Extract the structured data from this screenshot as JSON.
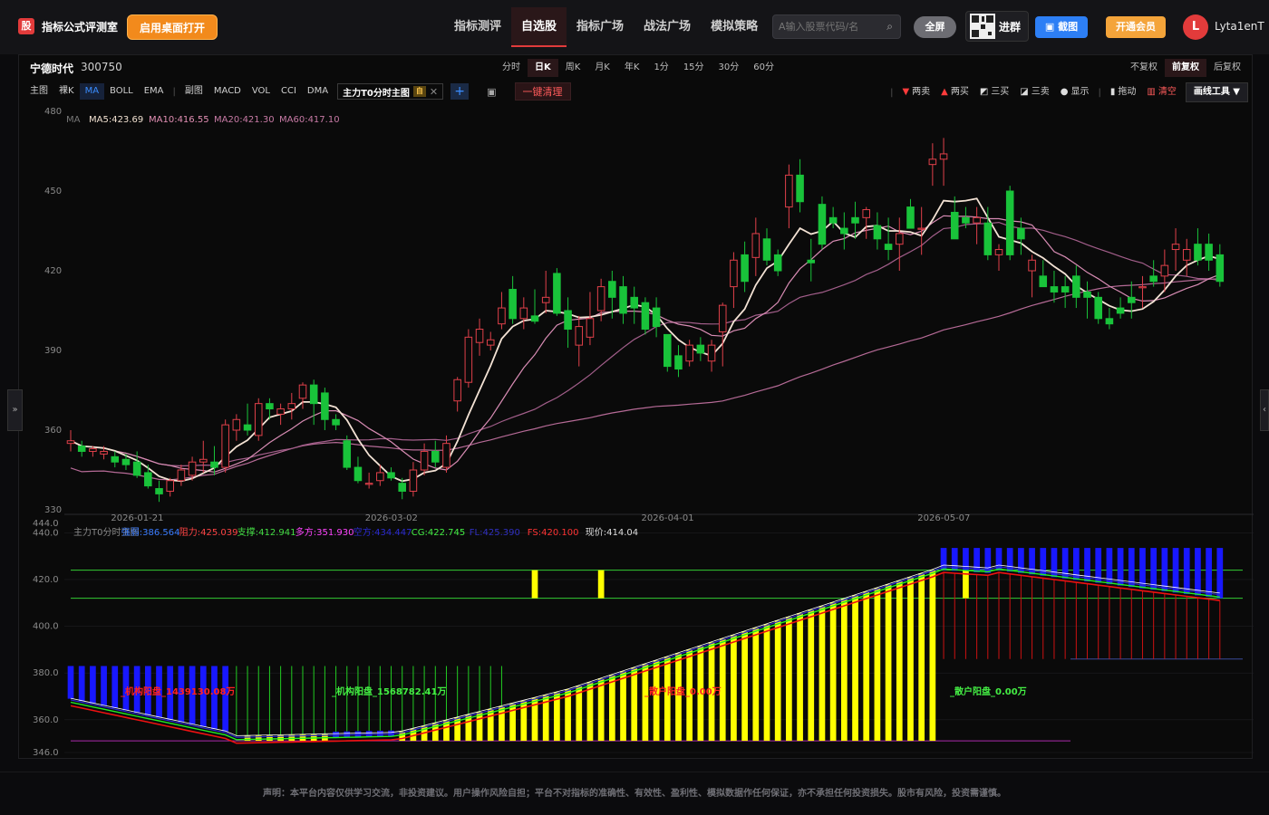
{
  "header": {
    "logo_mark": "股",
    "logo_text": "指标公式评测室",
    "desktop_button": "启用桌面打开",
    "nav": [
      "指标测评",
      "自选股",
      "指标广场",
      "战法广场",
      "模拟策略"
    ],
    "nav_active": 1,
    "search_placeholder": "A输入股票代码/名",
    "fullscreen": "全屏",
    "join_group": "进群",
    "screenshot": "截图",
    "member": "开通会员",
    "avatar_letter": "L",
    "username": "Lyta1enT"
  },
  "stock": {
    "name": "宁德时代",
    "code": "300750"
  },
  "periods": [
    "分时",
    "日K",
    "周K",
    "月K",
    "年K",
    "1分",
    "15分",
    "30分",
    "60分"
  ],
  "period_active": 1,
  "adjust": [
    "不复权",
    "前复权",
    "后复权"
  ],
  "adjust_active": 1,
  "indicators_main": [
    "主图",
    "裸K",
    "MA",
    "BOLL",
    "EMA"
  ],
  "indicator_active": 2,
  "indicators_sub": [
    "副图",
    "MACD",
    "VOL",
    "CCI",
    "DMA"
  ],
  "custom_indicator": {
    "name": "主力T0分时主图",
    "badge": "自"
  },
  "clear_all": "一键清理",
  "tools": [
    {
      "icon": "▼",
      "label": "两卖",
      "color": "#ff3b3b"
    },
    {
      "icon": "▲",
      "label": "两买",
      "color": "#ff3b3b"
    },
    {
      "icon": "◩",
      "label": "三买",
      "color": "#dddddd"
    },
    {
      "icon": "◪",
      "label": "三卖",
      "color": "#dddddd"
    },
    {
      "icon": "●",
      "label": "显示",
      "color": "#dddddd"
    },
    {
      "icon": "▮",
      "label": "拖动",
      "color": "#dddddd"
    },
    {
      "icon": "▥",
      "label": "清空",
      "color": "#ff5b5b"
    }
  ],
  "draw_tools": "画线工具 ▼",
  "ma_legend": [
    {
      "label": "MA",
      "color": "#777777"
    },
    {
      "label": "MA5:423.69",
      "color": "#f0e0d0"
    },
    {
      "label": "MA10:416.55",
      "color": "#e28fb4"
    },
    {
      "label": "MA20:421.30",
      "color": "#c77aa5"
    },
    {
      "label": "MA60:417.10",
      "color": "#c77aa5"
    }
  ],
  "sub_legend": [
    {
      "label": "主力T0分时主图",
      "color": "#8a8a8a"
    },
    {
      "label": "强弱:386.564",
      "color": "#3a7cff"
    },
    {
      "label": "阻力:425.039",
      "color": "#ff4444"
    },
    {
      "label": "支撑:412.941",
      "color": "#44dd44"
    },
    {
      "label": "多方:351.930",
      "color": "#ff44ff"
    },
    {
      "label": "空方:434.447",
      "color": "#2a2ad0"
    },
    {
      "label": "CG:422.745",
      "color": "#44ee44"
    },
    {
      "label": "FL:425.390",
      "color": "#3030c0"
    },
    {
      "label": "FS:420.100",
      "color": "#ff3333"
    },
    {
      "label": "现价:414.04",
      "color": "#dddddd"
    }
  ],
  "annotations": [
    {
      "text": "_机构阳盘_1439130.08万",
      "color": "#ff2222"
    },
    {
      "text": "_机构阳盘_1568782.41万",
      "color": "#44ee44"
    },
    {
      "text": "_散户阳盘_0.00万",
      "color": "#ff2222"
    },
    {
      "text": "_散户阳盘_0.00万",
      "color": "#44ee44"
    }
  ],
  "chart_data": {
    "type": "candlestick",
    "price_axis": {
      "ticks": [
        480,
        450,
        420,
        390,
        360,
        330
      ],
      "ylim": [
        330,
        480
      ]
    },
    "sub_axis": {
      "ticks": [
        "444.0",
        "440.0",
        "420.0",
        "400.0",
        "380.0",
        "360.0",
        "346.0"
      ],
      "ylim": [
        346,
        444
      ]
    },
    "date_labels": [
      "2026-01-21",
      "2026-03-02",
      "2026-04-01",
      "2026-05-07"
    ],
    "ohlc": [
      [
        355,
        360,
        352,
        356
      ],
      [
        354,
        356,
        350,
        352
      ],
      [
        352,
        354,
        350,
        353
      ],
      [
        351,
        354,
        349,
        352
      ],
      [
        350,
        352,
        346,
        348
      ],
      [
        349,
        351,
        345,
        347
      ],
      [
        348,
        352,
        342,
        343
      ],
      [
        344,
        347,
        338,
        339
      ],
      [
        338,
        341,
        333,
        336
      ],
      [
        337,
        342,
        335,
        341
      ],
      [
        341,
        347,
        339,
        345
      ],
      [
        343,
        350,
        341,
        348
      ],
      [
        348,
        356,
        344,
        349
      ],
      [
        348,
        354,
        343,
        346
      ],
      [
        346,
        364,
        344,
        362
      ],
      [
        360,
        366,
        356,
        364
      ],
      [
        362,
        370,
        358,
        360
      ],
      [
        358,
        372,
        356,
        370
      ],
      [
        370,
        372,
        364,
        368
      ],
      [
        366,
        370,
        362,
        368
      ],
      [
        368,
        374,
        364,
        370
      ],
      [
        372,
        378,
        368,
        377
      ],
      [
        377,
        379,
        362,
        370
      ],
      [
        374,
        376,
        360,
        364
      ],
      [
        364,
        366,
        360,
        362
      ],
      [
        356,
        358,
        345,
        346
      ],
      [
        346,
        350,
        340,
        341
      ],
      [
        340,
        344,
        338,
        340
      ],
      [
        341,
        347,
        339,
        344
      ],
      [
        344,
        346,
        341,
        342
      ],
      [
        340,
        342,
        334,
        337
      ],
      [
        337,
        348,
        335,
        345
      ],
      [
        345,
        355,
        343,
        352
      ],
      [
        352,
        356,
        346,
        348
      ],
      [
        346,
        358,
        344,
        355
      ],
      [
        371,
        380,
        367,
        379
      ],
      [
        378,
        398,
        376,
        395
      ],
      [
        393,
        402,
        388,
        398
      ],
      [
        392,
        397,
        390,
        394
      ],
      [
        400,
        412,
        398,
        406
      ],
      [
        413,
        418,
        400,
        402
      ],
      [
        402,
        410,
        398,
        406
      ],
      [
        403,
        413,
        400,
        401
      ],
      [
        408,
        420,
        404,
        410
      ],
      [
        419,
        421,
        403,
        404
      ],
      [
        405,
        410,
        391,
        398
      ],
      [
        392,
        403,
        384,
        399
      ],
      [
        395,
        412,
        392,
        402
      ],
      [
        405,
        417,
        401,
        414
      ],
      [
        416,
        420,
        402,
        410
      ],
      [
        414,
        418,
        400,
        404
      ],
      [
        410,
        414,
        400,
        406
      ],
      [
        408,
        410,
        396,
        398
      ],
      [
        406,
        410,
        395,
        399
      ],
      [
        396,
        396,
        382,
        384
      ],
      [
        388,
        392,
        380,
        383
      ],
      [
        386,
        394,
        384,
        392
      ],
      [
        392,
        395,
        386,
        389
      ],
      [
        386,
        394,
        382,
        392
      ],
      [
        397,
        408,
        384,
        407
      ],
      [
        414,
        427,
        406,
        424
      ],
      [
        426,
        431,
        412,
        416
      ],
      [
        425,
        440,
        418,
        434
      ],
      [
        432,
        436,
        422,
        424
      ],
      [
        426,
        428,
        418,
        420
      ],
      [
        444,
        460,
        436,
        456
      ],
      [
        456,
        462,
        442,
        446
      ],
      [
        424,
        432,
        416,
        423
      ],
      [
        445,
        448,
        428,
        430
      ],
      [
        440,
        444,
        436,
        438
      ],
      [
        436,
        442,
        428,
        434
      ],
      [
        440,
        446,
        432,
        438
      ],
      [
        440,
        444,
        432,
        443
      ],
      [
        437,
        442,
        428,
        432
      ],
      [
        430,
        440,
        424,
        428
      ],
      [
        430,
        440,
        420,
        434
      ],
      [
        444,
        447,
        438,
        436
      ],
      [
        436,
        444,
        426,
        436
      ],
      [
        460,
        468,
        452,
        462
      ],
      [
        462,
        470,
        452,
        464
      ],
      [
        442,
        448,
        434,
        432
      ],
      [
        440,
        444,
        436,
        438
      ],
      [
        438,
        444,
        430,
        440
      ],
      [
        438,
        444,
        424,
        426
      ],
      [
        426,
        430,
        420,
        428
      ],
      [
        450,
        452,
        424,
        426
      ],
      [
        436,
        440,
        426,
        432
      ],
      [
        420,
        426,
        410,
        424
      ],
      [
        418,
        424,
        414,
        414
      ],
      [
        414,
        420,
        408,
        412
      ],
      [
        414,
        418,
        406,
        412
      ],
      [
        418,
        422,
        406,
        410
      ],
      [
        412,
        416,
        402,
        410
      ],
      [
        410,
        412,
        400,
        402
      ],
      [
        402,
        406,
        398,
        400
      ],
      [
        406,
        410,
        402,
        404
      ],
      [
        410,
        416,
        402,
        408
      ],
      [
        414,
        418,
        406,
        414
      ],
      [
        418,
        424,
        414,
        416
      ],
      [
        418,
        428,
        412,
        422
      ],
      [
        428,
        436,
        420,
        430
      ],
      [
        424,
        432,
        418,
        428
      ],
      [
        430,
        436,
        422,
        424
      ],
      [
        430,
        434,
        420,
        424
      ],
      [
        426,
        430,
        414,
        416
      ]
    ],
    "sub_bars": {
      "blue_start": [
        0,
        15
      ],
      "yellow_main": [
        [
          15,
          24,
          "small"
        ],
        [
          31,
          76,
          "rise"
        ]
      ],
      "spikes": [
        [
          42,
          "yellow"
        ],
        [
          48,
          "yellow"
        ],
        [
          81,
          "yellow"
        ]
      ]
    }
  },
  "footer": {
    "disclaimer": "声明：本平台内容仅供学习交流，非投资建议。用户操作风险自担；平台不对指标的准确性、有效性、盈利性、模拟数据作任何保证，亦不承担任何投资损失。股市有风险，投资需谨慎。"
  }
}
